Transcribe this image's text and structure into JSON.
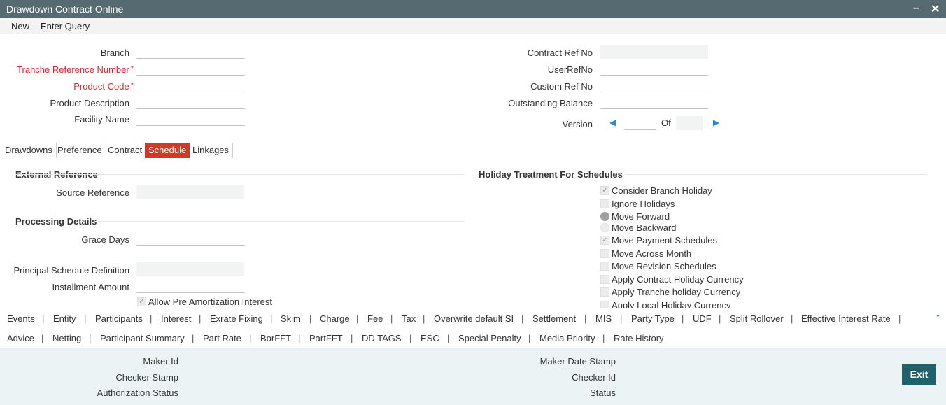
{
  "window": {
    "title": "Drawdown Contract Online",
    "minimize_glyph": "–",
    "close_glyph": "✕"
  },
  "menu": {
    "items": [
      "New",
      "Enter Query"
    ]
  },
  "header_left": {
    "branch": {
      "label": "Branch",
      "value": ""
    },
    "tranche_ref": {
      "label": "Tranche Reference Number",
      "required": "*",
      "value": ""
    },
    "product_code": {
      "label": "Product Code",
      "required": "*",
      "value": ""
    },
    "product_description": {
      "label": "Product Description",
      "value": ""
    },
    "facility_name": {
      "label": "Facility Name",
      "value": ""
    }
  },
  "header_right": {
    "contract_ref": {
      "label": "Contract Ref No",
      "value": ""
    },
    "user_ref": {
      "label": "UserRefNo",
      "value": ""
    },
    "custom_ref": {
      "label": "Custom Ref No",
      "value": ""
    },
    "outstanding_balance": {
      "label": "Outstanding Balance",
      "value": ""
    },
    "version": {
      "label": "Version",
      "of_label": "Of",
      "current": "",
      "total": ""
    }
  },
  "tabs": {
    "items": [
      "Drawdowns",
      "Preference",
      "Contract",
      "Schedule",
      "Linkages"
    ],
    "active": "Schedule"
  },
  "schedule": {
    "external_reference": {
      "title": "External Reference",
      "source_reference_label": "Source Reference",
      "source_reference_value": ""
    },
    "processing_details": {
      "title": "Processing Details",
      "grace_days_label": "Grace Days",
      "grace_days_value": "",
      "principal_schedule_label": "Principal Schedule Definition",
      "principal_schedule_value": "",
      "installment_amount_label": "Installment Amount",
      "installment_amount_value": "",
      "allow_pre_amortization_label": "Allow Pre Amortization Interest",
      "allow_pre_amortization_checked": true
    },
    "holiday_treatment": {
      "title": "Holiday Treatment For Schedules",
      "consider_branch_holiday": {
        "label": "Consider Branch Holiday",
        "checked": true
      },
      "ignore_holidays": {
        "label": "Ignore Holidays",
        "checked": false
      },
      "move_forward": {
        "label": "Move Forward",
        "selected": true
      },
      "move_backward": {
        "label": "Move Backward",
        "selected": false
      },
      "move_payment_schedules": {
        "label": "Move Payment Schedules",
        "checked": true
      },
      "move_across_month": {
        "label": "Move Across Month",
        "checked": false
      },
      "move_revision_schedules": {
        "label": "Move Revision Schedules",
        "checked": false
      },
      "apply_contract_holiday_currency": {
        "label": "Apply Contract Holiday Currency",
        "checked": false
      },
      "apply_tranche_holiday_currency": {
        "label": "Apply Tranche holiday Currency",
        "checked": false
      },
      "apply_local_holiday_currency": {
        "label": "Apply Local Holiday Currency",
        "checked": false
      }
    }
  },
  "subsystems_row1": [
    "Events",
    "Entity",
    "Participants",
    "Interest",
    "Exrate Fixing",
    "Skim",
    "Charge",
    "Fee",
    "Tax",
    "Overwrite default SI",
    "Settlement",
    "MIS",
    "Party Type",
    "UDF",
    "Split Rollover",
    "Effective Interest Rate"
  ],
  "subsystems_row2": [
    "Advice",
    "Netting",
    "Participant Summary",
    "Part Rate",
    "BorFFT",
    "PartFFT",
    "DD TAGS",
    "ESC",
    "Special Penalty",
    "Media Priority",
    "Rate History"
  ],
  "separator": "|",
  "footer": {
    "maker_id": "Maker Id",
    "checker_stamp": "Checker Stamp",
    "authorization_status": "Authorization Status",
    "maker_date_stamp": "Maker Date Stamp",
    "checker_id": "Checker Id",
    "status": "Status",
    "exit_label": "Exit"
  },
  "colors": {
    "titlebar": "#566b71",
    "active_tab": "#d23826",
    "required": "#d6282f",
    "exit_button": "#20616b",
    "footer_bg": "#ecf3f4",
    "arrow": "#2a8ad4"
  },
  "icons": {
    "prev": "triangle-left-icon",
    "next": "triangle-right-icon",
    "expand": "chevron-down-icon",
    "check": "check-icon"
  }
}
